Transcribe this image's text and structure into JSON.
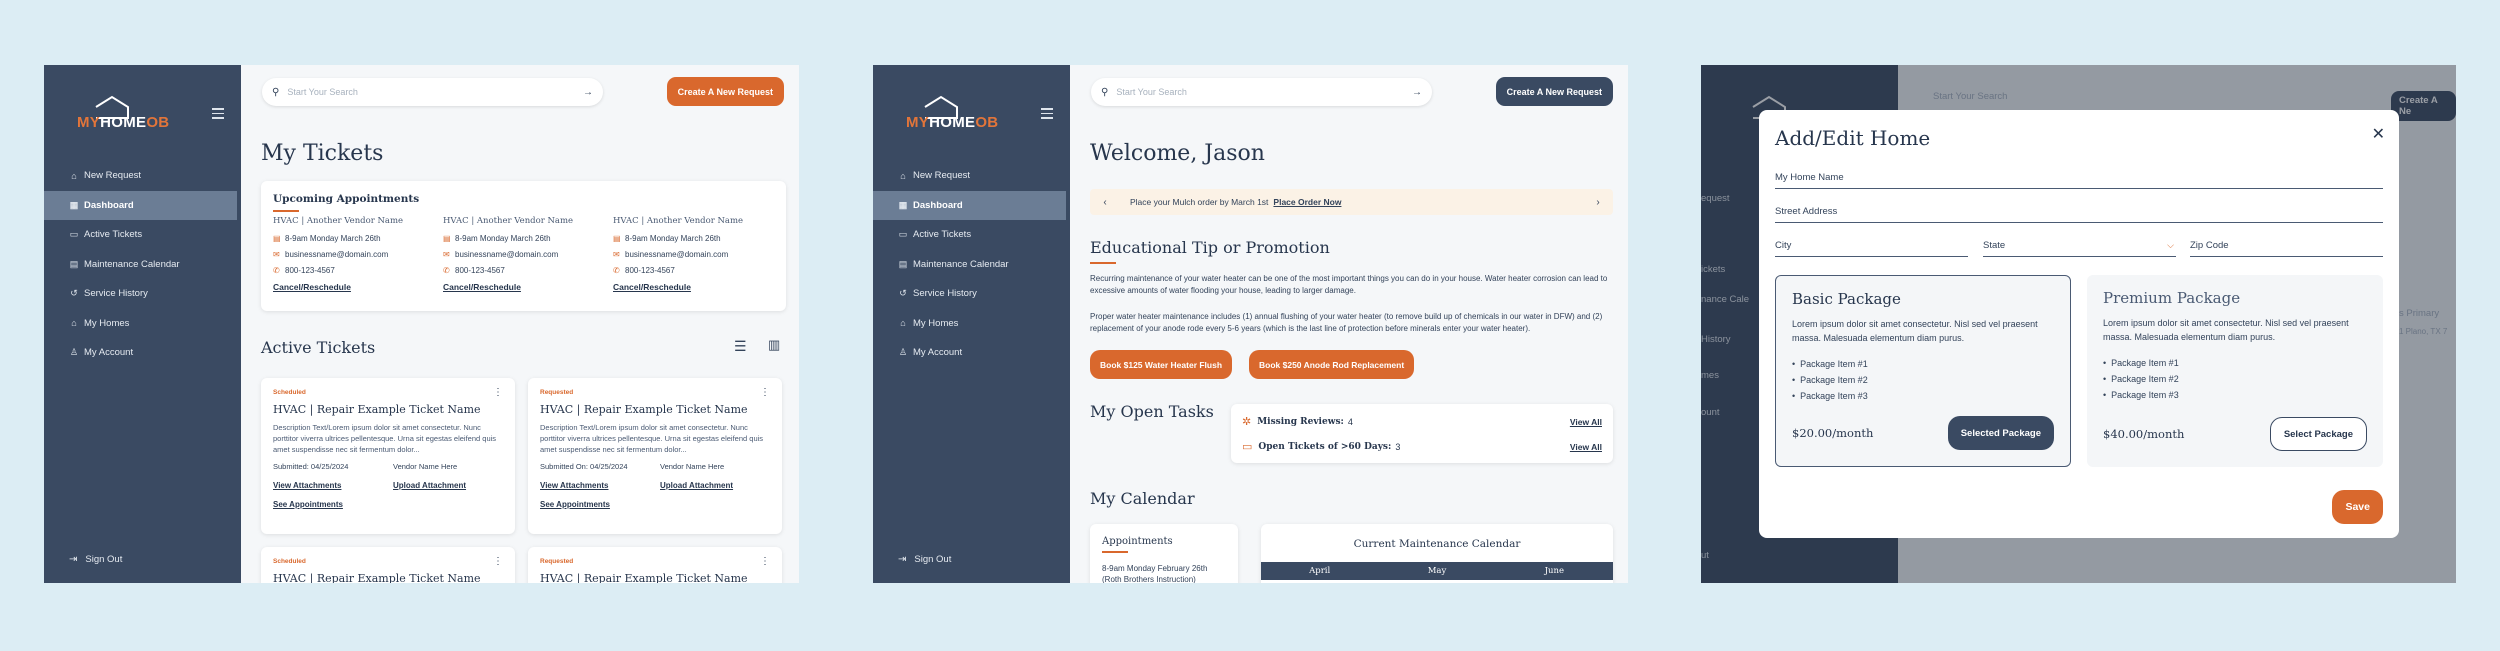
{
  "colors": {
    "navy": "#3a4a62",
    "orange": "#d9682d",
    "background": "#dcedf4"
  },
  "brand": {
    "prefix": "MY",
    "home": "HOME",
    "suffix": "OB"
  },
  "nav": [
    {
      "label": "New Request",
      "icon": "home-plus-icon"
    },
    {
      "label": "Dashboard",
      "icon": "grid-icon"
    },
    {
      "label": "Active Tickets",
      "icon": "ticket-icon"
    },
    {
      "label": "Maintenance Calendar",
      "icon": "calendar-icon"
    },
    {
      "label": "Service History",
      "icon": "history-icon"
    },
    {
      "label": "My Homes",
      "icon": "house-icon"
    },
    {
      "label": "My Account",
      "icon": "user-icon"
    }
  ],
  "signout": "Sign Out",
  "search_placeholder": "Start Your Search",
  "cta": "Create A New Request",
  "screen1": {
    "title": "My Tickets",
    "upcoming_title": "Upcoming Appointments",
    "appointments": [
      {
        "vendor": "HVAC | Another Vendor Name",
        "time": "8-9am Monday March 26th",
        "email": "businessname@domain.com",
        "phone": "800-123-4567",
        "action": "Cancel/Reschedule"
      },
      {
        "vendor": "HVAC | Another Vendor Name",
        "time": "8-9am Monday March 26th",
        "email": "businessname@domain.com",
        "phone": "800-123-4567",
        "action": "Cancel/Reschedule"
      },
      {
        "vendor": "HVAC | Another Vendor Name",
        "time": "8-9am Monday March 26th",
        "email": "businessname@domain.com",
        "phone": "800-123-4567",
        "action": "Cancel/Reschedule"
      }
    ],
    "active_title": "Active Tickets",
    "tickets": [
      {
        "status": "Scheduled",
        "name": "HVAC | Repair Example Ticket Name",
        "desc": "Description Text/Lorem ipsum dolor sit amet consectetur. Nunc porttitor viverra ultrices pellentesque. Urna sit egestas eleifend quis amet suspendisse nec sit fermentum dolor...",
        "submitted": "Submitted: 04/25/2024",
        "vendor": "Vendor Name Here",
        "link1": "View Attachments",
        "link2": "Upload Attachment",
        "link3": "See Appointments"
      },
      {
        "status": "Requested",
        "name": "HVAC | Repair Example Ticket Name",
        "desc": "Description Text/Lorem ipsum dolor sit amet consectetur. Nunc porttitor viverra ultrices pellentesque. Urna sit egestas eleifend quis amet suspendisse nec sit fermentum dolor...",
        "submitted": "Submitted On: 04/25/2024",
        "vendor": "Vendor Name Here",
        "link1": "View Attachments",
        "link2": "Upload Attachment",
        "link3": "See Appointments"
      },
      {
        "status": "Scheduled",
        "name": "HVAC | Repair Example Ticket Name"
      },
      {
        "status": "Requested",
        "name": "HVAC | Repair Example Ticket Name"
      }
    ]
  },
  "screen2": {
    "title": "Welcome, Jason",
    "banner_text": "Place your Mulch order by March 1st",
    "banner_link": "Place Order Now",
    "tip_title": "Educational Tip or Promotion",
    "tip_p1": "Recurring maintenance of your water heater can be one of the most important things you can do in your house. Water heater corrosion can lead to excessive amounts of water flooding your house, leading to larger damage.",
    "tip_p2": "Proper water heater maintenance includes (1) annual flushing of your water heater (to remove build up of chemicals in our water in DFW) and (2) replacement of your anode rode every 5-6 years (which is the last line of protection before minerals enter your water heater).",
    "btn1": "Book $125 Water Heater Flush",
    "btn2": "Book $250 Anode Rod Replacement",
    "tasks_title": "My Open Tasks",
    "task1_label": "Missing Reviews:",
    "task1_value": "4",
    "task2_label": "Open Tickets of >60 Days:",
    "task2_value": "3",
    "view_all": "View All",
    "calendar_title": "My Calendar",
    "appts_title": "Appointments",
    "appt_text": "8-9am Monday February 26th (Roth Brothers Instruction)",
    "cal_title": "Current Maintenance Calendar",
    "months": [
      "April",
      "May",
      "June"
    ]
  },
  "screen3": {
    "modal_title": "Add/Edit Home",
    "fields": {
      "name": "My Home Name",
      "street": "Street Address",
      "city": "City",
      "state": "State",
      "zip": "Zip Code"
    },
    "packages": [
      {
        "title": "Basic Package",
        "desc": "Lorem ipsum dolor sit amet consectetur. Nisl sed vel praesent massa. Malesuada elementum diam purus.",
        "items": [
          "Package Item #1",
          "Package Item #2",
          "Package Item #3"
        ],
        "price": "$20.00/month",
        "button": "Selected Package"
      },
      {
        "title": "Premium Package",
        "desc": "Lorem ipsum dolor sit amet consectetur. Nisl sed vel praesent massa. Malesuada elementum diam purus.",
        "items": [
          "Package Item #1",
          "Package Item #2",
          "Package Item #3"
        ],
        "price": "$40.00/month",
        "button": "Select Package"
      }
    ],
    "save": "Save",
    "bg_fragments": [
      "equest",
      "ickets",
      "nance Cale",
      "History",
      "mes",
      "ount",
      "ut",
      "Start Your Search",
      "Create A Ne",
      "s Primary",
      "1 Plano, TX 7"
    ]
  }
}
